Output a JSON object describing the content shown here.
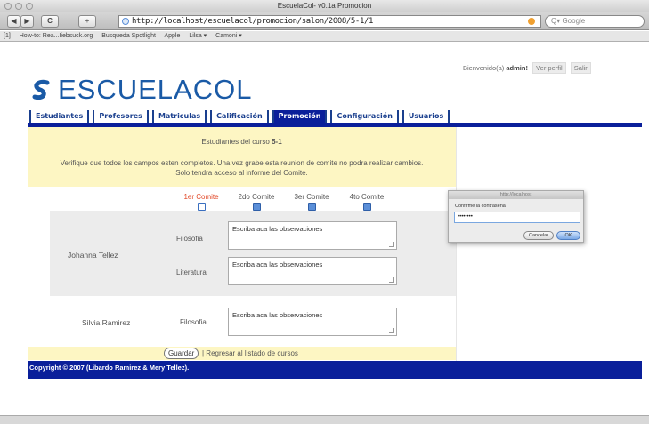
{
  "window": {
    "title": "EscuelaCol- v0.1a Promocion"
  },
  "toolbar": {
    "back": "◀",
    "forward": "▶",
    "reload": "C",
    "stop": "⌘",
    "add": "+",
    "url": "http://localhost/escuelacol/promocion/salon/2008/5-1/1",
    "search_placeholder": "Q▾ Google"
  },
  "bookmarks": [
    "[1]",
    "How-to: Rea...Iiebsuck.org",
    "Busqueda Spotlight",
    "Apple",
    "Lilsa ▾",
    "Camoni ▾"
  ],
  "userbar": {
    "greeting": "Bienvenido(a)",
    "user": "admin!",
    "profile": "Ver perfil",
    "logout": "Salir"
  },
  "logo": {
    "text": "ESCUELACOL"
  },
  "tabs": [
    {
      "label": "Estudiantes",
      "active": false
    },
    {
      "label": "Profesores",
      "active": false
    },
    {
      "label": "Matriculas",
      "active": false
    },
    {
      "label": "Calificación",
      "active": false
    },
    {
      "label": "Promoción",
      "active": true
    },
    {
      "label": "Configuración",
      "active": false
    },
    {
      "label": "Usuarios",
      "active": false
    }
  ],
  "notice": {
    "line1_prefix": "Estudiantes del curso",
    "course": "5-1",
    "line2": "Verifique que todos los campos esten completos. Una vez grabe esta reunion de comite no podra realizar cambios.",
    "line3": "Solo tendra acceso al informe del Comite."
  },
  "comites": [
    "1er Comite",
    "2do Comite",
    "3er Comite",
    "4to Comite"
  ],
  "students": [
    {
      "name": "Johanna Tellez",
      "subjects": [
        {
          "subject": "Filosofia",
          "value": "Escriba aca las observaciones"
        },
        {
          "subject": "Literatura",
          "value": "Escriba aca las observaciones"
        }
      ]
    },
    {
      "name": "Silvia Ramirez",
      "subjects": [
        {
          "subject": "Filosofia",
          "value": "Escriba aca las observaciones"
        }
      ]
    }
  ],
  "actions": {
    "save": "Guardar",
    "back_link": "| Regresar al listado de cursos"
  },
  "footer": {
    "copyright": "Copyright © 2007 (Libardo Ramirez & Mery Tellez)."
  },
  "dialog": {
    "title": "http://localhost",
    "label": "Confirme la contraseña",
    "value": "••••••••",
    "cancel": "Cancelar",
    "ok": "OK"
  }
}
